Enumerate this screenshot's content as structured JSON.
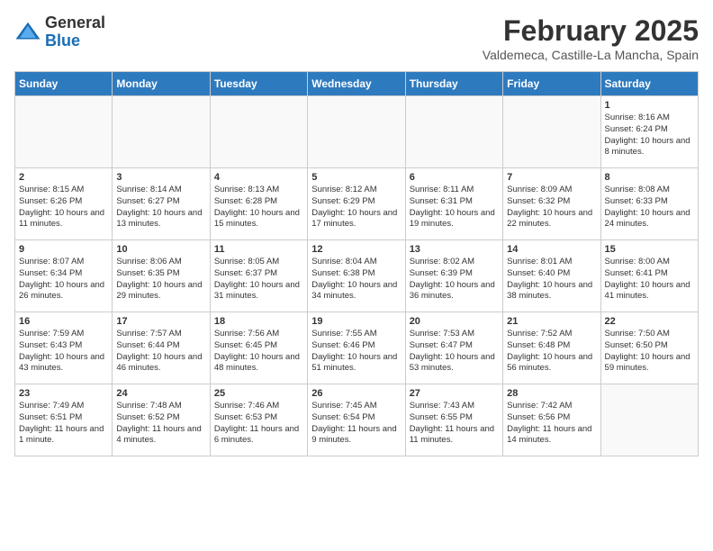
{
  "logo": {
    "general": "General",
    "blue": "Blue"
  },
  "title": "February 2025",
  "location": "Valdemeca, Castille-La Mancha, Spain",
  "days_of_week": [
    "Sunday",
    "Monday",
    "Tuesday",
    "Wednesday",
    "Thursday",
    "Friday",
    "Saturday"
  ],
  "weeks": [
    [
      {
        "day": "",
        "info": ""
      },
      {
        "day": "",
        "info": ""
      },
      {
        "day": "",
        "info": ""
      },
      {
        "day": "",
        "info": ""
      },
      {
        "day": "",
        "info": ""
      },
      {
        "day": "",
        "info": ""
      },
      {
        "day": "1",
        "info": "Sunrise: 8:16 AM\nSunset: 6:24 PM\nDaylight: 10 hours and 8 minutes."
      }
    ],
    [
      {
        "day": "2",
        "info": "Sunrise: 8:15 AM\nSunset: 6:26 PM\nDaylight: 10 hours and 11 minutes."
      },
      {
        "day": "3",
        "info": "Sunrise: 8:14 AM\nSunset: 6:27 PM\nDaylight: 10 hours and 13 minutes."
      },
      {
        "day": "4",
        "info": "Sunrise: 8:13 AM\nSunset: 6:28 PM\nDaylight: 10 hours and 15 minutes."
      },
      {
        "day": "5",
        "info": "Sunrise: 8:12 AM\nSunset: 6:29 PM\nDaylight: 10 hours and 17 minutes."
      },
      {
        "day": "6",
        "info": "Sunrise: 8:11 AM\nSunset: 6:31 PM\nDaylight: 10 hours and 19 minutes."
      },
      {
        "day": "7",
        "info": "Sunrise: 8:09 AM\nSunset: 6:32 PM\nDaylight: 10 hours and 22 minutes."
      },
      {
        "day": "8",
        "info": "Sunrise: 8:08 AM\nSunset: 6:33 PM\nDaylight: 10 hours and 24 minutes."
      }
    ],
    [
      {
        "day": "9",
        "info": "Sunrise: 8:07 AM\nSunset: 6:34 PM\nDaylight: 10 hours and 26 minutes."
      },
      {
        "day": "10",
        "info": "Sunrise: 8:06 AM\nSunset: 6:35 PM\nDaylight: 10 hours and 29 minutes."
      },
      {
        "day": "11",
        "info": "Sunrise: 8:05 AM\nSunset: 6:37 PM\nDaylight: 10 hours and 31 minutes."
      },
      {
        "day": "12",
        "info": "Sunrise: 8:04 AM\nSunset: 6:38 PM\nDaylight: 10 hours and 34 minutes."
      },
      {
        "day": "13",
        "info": "Sunrise: 8:02 AM\nSunset: 6:39 PM\nDaylight: 10 hours and 36 minutes."
      },
      {
        "day": "14",
        "info": "Sunrise: 8:01 AM\nSunset: 6:40 PM\nDaylight: 10 hours and 38 minutes."
      },
      {
        "day": "15",
        "info": "Sunrise: 8:00 AM\nSunset: 6:41 PM\nDaylight: 10 hours and 41 minutes."
      }
    ],
    [
      {
        "day": "16",
        "info": "Sunrise: 7:59 AM\nSunset: 6:43 PM\nDaylight: 10 hours and 43 minutes."
      },
      {
        "day": "17",
        "info": "Sunrise: 7:57 AM\nSunset: 6:44 PM\nDaylight: 10 hours and 46 minutes."
      },
      {
        "day": "18",
        "info": "Sunrise: 7:56 AM\nSunset: 6:45 PM\nDaylight: 10 hours and 48 minutes."
      },
      {
        "day": "19",
        "info": "Sunrise: 7:55 AM\nSunset: 6:46 PM\nDaylight: 10 hours and 51 minutes."
      },
      {
        "day": "20",
        "info": "Sunrise: 7:53 AM\nSunset: 6:47 PM\nDaylight: 10 hours and 53 minutes."
      },
      {
        "day": "21",
        "info": "Sunrise: 7:52 AM\nSunset: 6:48 PM\nDaylight: 10 hours and 56 minutes."
      },
      {
        "day": "22",
        "info": "Sunrise: 7:50 AM\nSunset: 6:50 PM\nDaylight: 10 hours and 59 minutes."
      }
    ],
    [
      {
        "day": "23",
        "info": "Sunrise: 7:49 AM\nSunset: 6:51 PM\nDaylight: 11 hours and 1 minute."
      },
      {
        "day": "24",
        "info": "Sunrise: 7:48 AM\nSunset: 6:52 PM\nDaylight: 11 hours and 4 minutes."
      },
      {
        "day": "25",
        "info": "Sunrise: 7:46 AM\nSunset: 6:53 PM\nDaylight: 11 hours and 6 minutes."
      },
      {
        "day": "26",
        "info": "Sunrise: 7:45 AM\nSunset: 6:54 PM\nDaylight: 11 hours and 9 minutes."
      },
      {
        "day": "27",
        "info": "Sunrise: 7:43 AM\nSunset: 6:55 PM\nDaylight: 11 hours and 11 minutes."
      },
      {
        "day": "28",
        "info": "Sunrise: 7:42 AM\nSunset: 6:56 PM\nDaylight: 11 hours and 14 minutes."
      },
      {
        "day": "",
        "info": ""
      }
    ]
  ]
}
